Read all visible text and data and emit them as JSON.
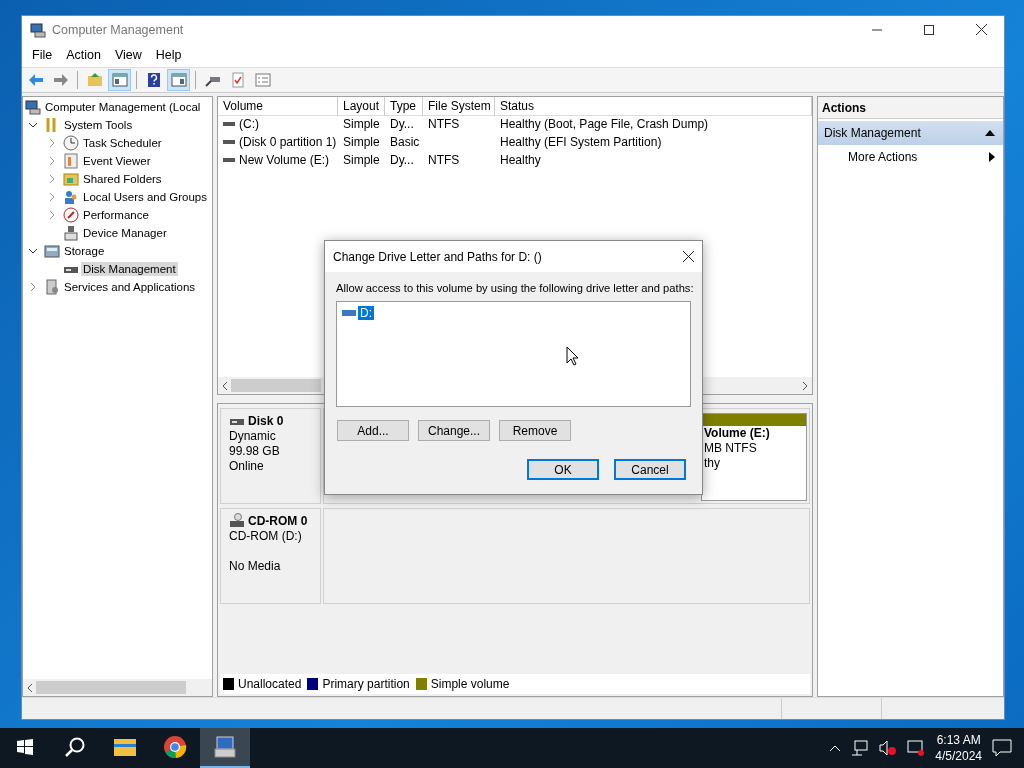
{
  "window": {
    "title": "Computer Management"
  },
  "menu": [
    "File",
    "Action",
    "View",
    "Help"
  ],
  "toolbar": [
    {
      "kind": "back",
      "pressed": false
    },
    {
      "kind": "forward",
      "pressed": false
    },
    {
      "kind": "up",
      "pressed": false
    },
    {
      "kind": "tree",
      "pressed": true
    },
    {
      "kind": "help",
      "pressed": false
    },
    {
      "kind": "pane",
      "pressed": true
    },
    {
      "kind": "connect",
      "pressed": false
    },
    {
      "kind": "check",
      "pressed": false
    },
    {
      "kind": "list",
      "pressed": false
    }
  ],
  "tree": [
    {
      "label": "Computer Management (Local",
      "kind": "computer",
      "selected": false,
      "children": [
        {
          "label": "System Tools",
          "kind": "tools",
          "expanded": true,
          "selected": false,
          "children": [
            {
              "label": "Task Scheduler",
              "kind": "clock",
              "expanded": false,
              "selected": false
            },
            {
              "label": "Event Viewer",
              "kind": "event",
              "expanded": false,
              "selected": false
            },
            {
              "label": "Shared Folders",
              "kind": "folder",
              "expanded": false,
              "selected": false
            },
            {
              "label": "Local Users and Groups",
              "kind": "users",
              "expanded": false,
              "selected": false
            },
            {
              "label": "Performance",
              "kind": "performance",
              "expanded": false,
              "selected": false
            },
            {
              "label": "Device Manager",
              "kind": "device",
              "selected": false
            }
          ]
        },
        {
          "label": "Storage",
          "kind": "storage",
          "expanded": true,
          "selected": false,
          "children": [
            {
              "label": "Disk Management",
              "kind": "disk",
              "selected": true
            }
          ]
        },
        {
          "label": "Services and Applications",
          "kind": "services",
          "expanded": false,
          "selected": false
        }
      ]
    }
  ],
  "volumes": {
    "columns": [
      "Volume",
      "Layout",
      "Type",
      "File System",
      "Status"
    ],
    "rows": [
      [
        "(C:)",
        "Simple",
        "Dy...",
        "NTFS",
        "Healthy (Boot, Page File, Crash Dump)"
      ],
      [
        "(Disk 0 partition 1)",
        "Simple",
        "Basic",
        "",
        "Healthy (EFI System Partition)"
      ],
      [
        "New Volume (E:)",
        "Simple",
        "Dy...",
        "NTFS",
        "Healthy"
      ]
    ]
  },
  "disks": [
    {
      "name": "Disk 0",
      "kind": "disk",
      "type": "Dynamic",
      "size": "99.98 GB",
      "status": "Online",
      "partitions": [
        {
          "color": "#808000",
          "lines": [
            "Volume  (E:)",
            "MB NTFS",
            "thy"
          ]
        }
      ]
    },
    {
      "name": "CD-ROM 0",
      "kind": "cdrom",
      "type": "CD-ROM (D:)",
      "status": "No Media"
    }
  ],
  "legend": [
    {
      "label": "Unallocated",
      "color": "#000000"
    },
    {
      "label": "Primary partition",
      "color": "#000080"
    },
    {
      "label": "Simple volume",
      "color": "#808000"
    }
  ],
  "actions": {
    "title": "Actions",
    "groups": [
      {
        "label": "Disk Management",
        "expanded": true,
        "items": [
          "More Actions"
        ]
      }
    ]
  },
  "dialog": {
    "title": "Change Drive Letter and Paths for D: ()",
    "prompt": "Allow access to this volume by using the following drive letter and paths:",
    "paths": [
      {
        "label": "D:",
        "selected": true
      }
    ],
    "buttons": [
      "Add...",
      "Change...",
      "Remove"
    ],
    "footer": [
      "OK",
      "Cancel"
    ]
  },
  "taskbar": {
    "apps": [
      {
        "kind": "start",
        "active": false
      },
      {
        "kind": "search",
        "active": false
      },
      {
        "kind": "explorer",
        "active": false
      },
      {
        "kind": "browser",
        "active": false
      },
      {
        "kind": "compmgmt",
        "active": true
      }
    ],
    "time": "6:13 AM",
    "date": "4/5/2024"
  }
}
